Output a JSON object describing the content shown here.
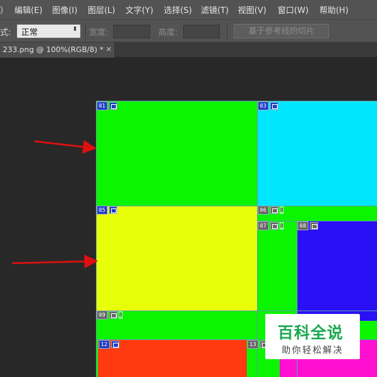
{
  "menu": {
    "items": [
      "）",
      "编辑(E)",
      "图像(I)",
      "图层(L)",
      "文字(Y)",
      "选择(S)",
      "滤镜(T)",
      "视图(V)",
      "窗口(W)",
      "帮助(H)"
    ]
  },
  "options": {
    "style_label": "式:",
    "style_value": "正常",
    "width_label": "宽度:",
    "height_label": "高度:",
    "width_value": "",
    "height_value": "",
    "guides_button": "基于参考线的切片"
  },
  "document_tab": {
    "title": "233.png @ 100%(RGB/8) *",
    "close": "×"
  },
  "slices": [
    {
      "num": "01",
      "extra": ""
    },
    {
      "num": "03",
      "extra": ""
    },
    {
      "num": "05",
      "extra": ""
    },
    {
      "num": "06",
      "extra": "8"
    },
    {
      "num": "07",
      "extra": "8"
    },
    {
      "num": "08",
      "extra": ""
    },
    {
      "num": "09",
      "extra": "8"
    },
    {
      "num": "12",
      "extra": ""
    },
    {
      "num": "13",
      "extra": ""
    }
  ],
  "colors": {
    "green": "#0bf500",
    "cyan": "#00e6ff",
    "yellow": "#e8ff0a",
    "blue": "#2a10f5",
    "red": "#ff3a10",
    "magenta": "#ff10d0",
    "arrow": "#e01010"
  },
  "watermark": {
    "title": "百科全说",
    "subtitle": "助你轻松解决"
  }
}
